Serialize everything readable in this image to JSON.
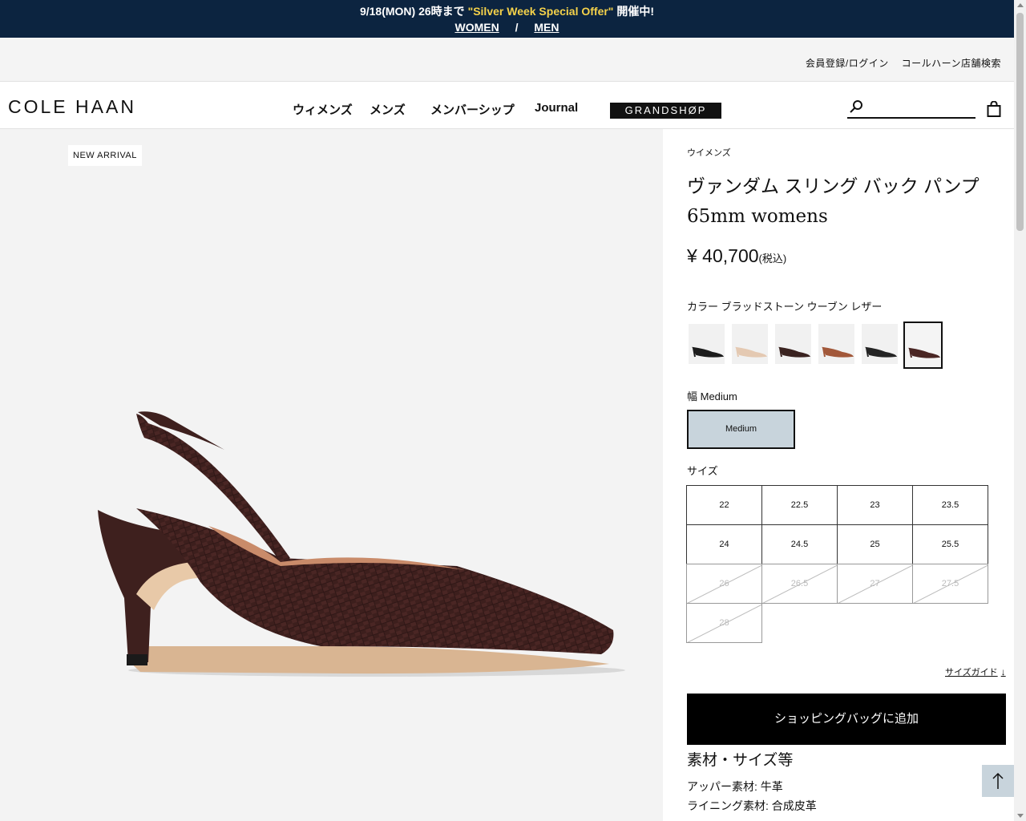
{
  "promo": {
    "date_text": "9/18(MON) 26時まで",
    "offer": "\"Silver Week Special Offer\"",
    "suffix": "開催中!",
    "link_women": "WOMEN",
    "separator": "/",
    "link_men": "MEN"
  },
  "utility": {
    "login": "会員登録/ログイン",
    "store_search": "コールハーン店舗検索"
  },
  "header": {
    "logo": "COLE HAAN",
    "nav": [
      "ウィメンズ",
      "メンズ",
      "メンバーシップ",
      "Journal"
    ],
    "grandshop": "GRANDSHØP",
    "search_placeholder": ""
  },
  "image": {
    "badge": "NEW ARRIVAL"
  },
  "product": {
    "category": "ウイメンズ",
    "name_line1": "ヴァンダム スリング バック パンプ",
    "name_line2": "65mm womens",
    "price": "¥ 40,700",
    "tax_note": "(税込)",
    "color_label": "カラー ブラッドストーン ウーブン レザー",
    "swatches": [
      {
        "name": "black",
        "color": "#1c1c1c"
      },
      {
        "name": "beige",
        "color": "#e4c9b2"
      },
      {
        "name": "dark-brown",
        "color": "#3a2320"
      },
      {
        "name": "tan",
        "color": "#a2583a"
      },
      {
        "name": "black-leather",
        "color": "#242424"
      },
      {
        "name": "bloodstone",
        "color": "#4a2624",
        "selected": true
      }
    ],
    "width_label": "幅 Medium",
    "width_option": "Medium",
    "size_label": "サイズ",
    "sizes": [
      {
        "label": "22",
        "available": true
      },
      {
        "label": "22.5",
        "available": true
      },
      {
        "label": "23",
        "available": true
      },
      {
        "label": "23.5",
        "available": true
      },
      {
        "label": "24",
        "available": true
      },
      {
        "label": "24.5",
        "available": true
      },
      {
        "label": "25",
        "available": true
      },
      {
        "label": "25.5",
        "available": true
      },
      {
        "label": "26",
        "available": false
      },
      {
        "label": "26.5",
        "available": false
      },
      {
        "label": "27",
        "available": false
      },
      {
        "label": "27.5",
        "available": false
      },
      {
        "label": "28",
        "available": false
      }
    ],
    "size_guide": "サイズガイド",
    "size_guide_arrow": "↓",
    "add_to_bag": "ショッピングバッグに追加",
    "materials_title": "素材・サイズ等",
    "materials": [
      "アッパー素材: 牛革",
      "ライニング素材: 合成皮革"
    ]
  },
  "colors": {
    "promo_bg": "#0c2440",
    "promo_highlight": "#f5d24a",
    "width_selected_bg": "#c8d4dc",
    "shoe": "#4a2624"
  }
}
